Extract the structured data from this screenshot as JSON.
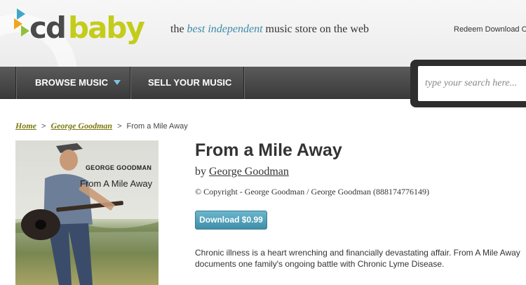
{
  "header": {
    "logo_text": "cdbaby",
    "tagline_prefix": "the ",
    "tagline_highlight": "best independent",
    "tagline_suffix": " music store on the web",
    "redeem_link": "Redeem Download C"
  },
  "nav": {
    "browse_label": "BROWSE MUSIC",
    "sell_label": "SELL YOUR MUSIC",
    "search_placeholder": "type your search here..."
  },
  "breadcrumb": {
    "home": "Home",
    "artist": "George Goodman",
    "current": "From a Mile Away",
    "separator": ">"
  },
  "album": {
    "cover_artist": "GEORGE GOODMAN",
    "cover_title": "From A Mile Away"
  },
  "product": {
    "title": "From a Mile Away",
    "by_prefix": "by ",
    "artist": "George Goodman",
    "copyright": "© Copyright - George Goodman / George Goodman (888174776149)",
    "download_label": "Download $0.99",
    "description": "Chronic illness is a heart wrenching and financially devastating affair. From A Mile Away documents one family's ongoing battle with Chronic Lyme Disease."
  },
  "colors": {
    "logo_green": "#c4cc1a",
    "logo_gray": "#4a4a4a",
    "accent_blue": "#3d8aa8",
    "link_olive": "#7a7a10",
    "nav_bg": "#454545"
  }
}
